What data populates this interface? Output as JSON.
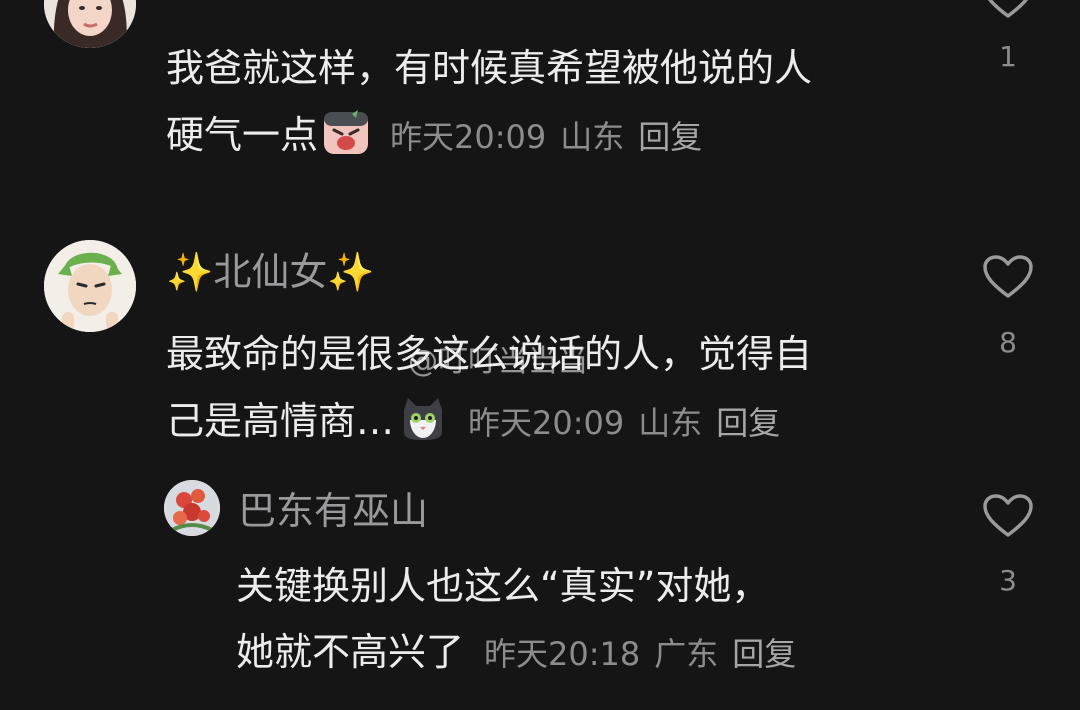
{
  "comments": [
    {
      "username": "",
      "lines": [
        "我爸就这样，有时候真希望被他说的人",
        "硬气一点"
      ],
      "time": "昨天20:09",
      "location": "山东",
      "reply_label": "回复",
      "likes": "1"
    },
    {
      "username_sparkle_left": "✨",
      "username": "北仙女",
      "username_sparkle_right": "✨",
      "lines": [
        "最致命的是很多这么说话的人，觉得自",
        "己是高情商…"
      ],
      "time": "昨天20:09",
      "location": "山东",
      "reply_label": "回复",
      "likes": "8"
    },
    {
      "username": "巴东有巫山",
      "lines": [
        "关键换别人也这么“真实”对她，",
        "她就不高兴了"
      ],
      "time": "昨天20:18",
      "location": "广东",
      "reply_label": "回复",
      "likes": "3"
    }
  ],
  "watermark": "@叮叮当当当",
  "icons": {
    "like": "heart-outline-icon",
    "emoji1": "crying-face-emoji",
    "emoji2": "cat-face-emoji"
  },
  "colors": {
    "background": "#151516",
    "text": "#ececec",
    "meta": "#8c8c8e"
  }
}
